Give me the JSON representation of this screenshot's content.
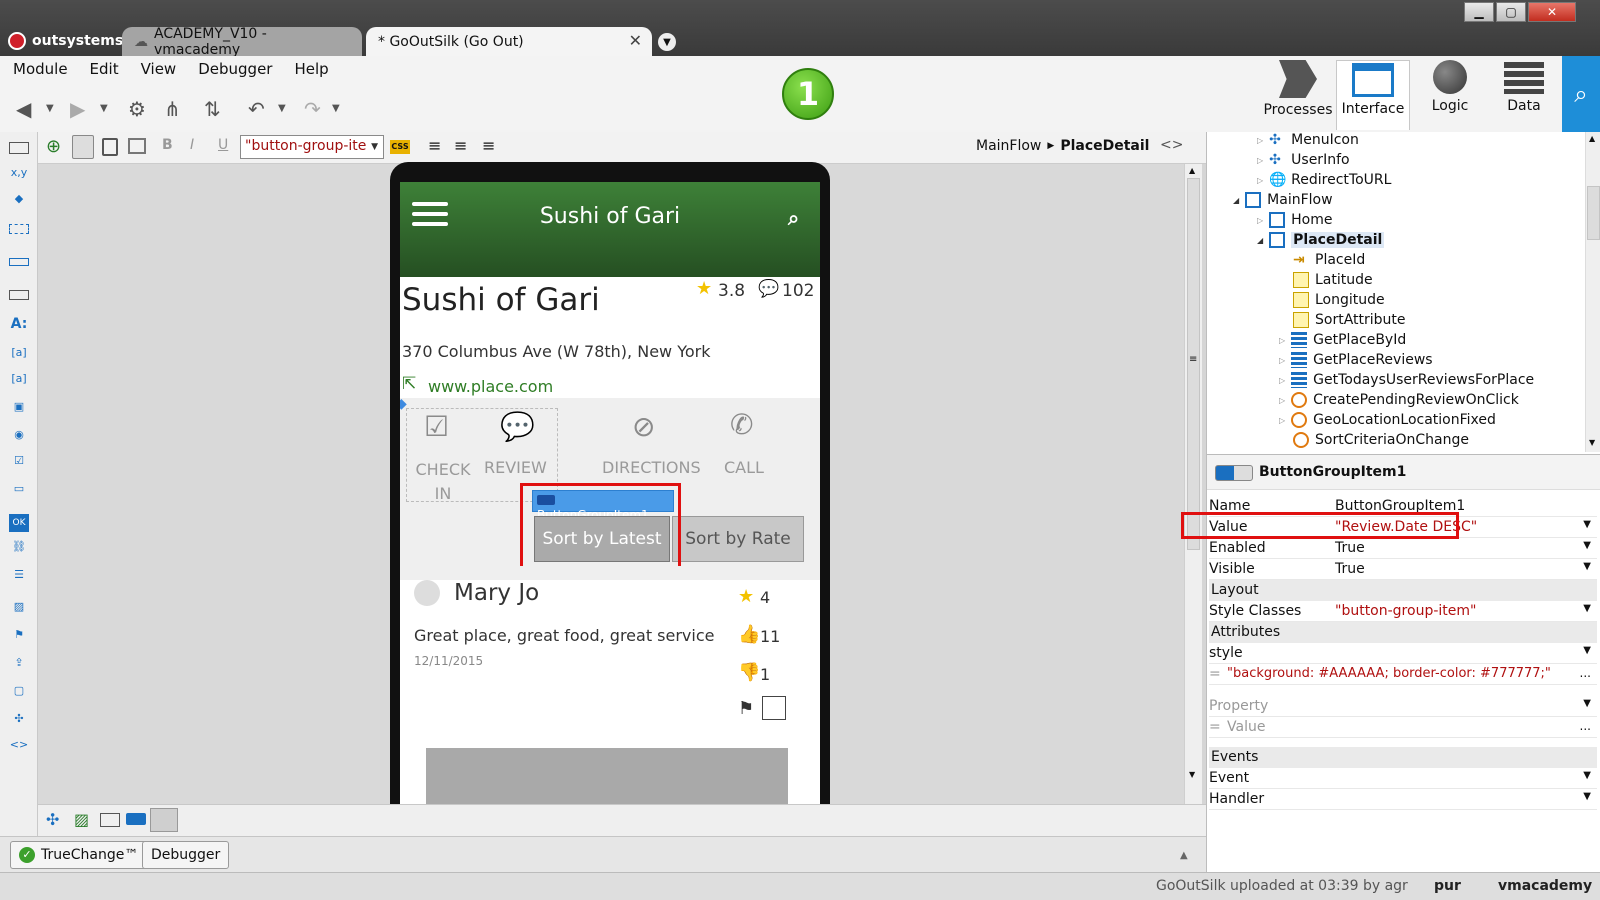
{
  "titlebar": {
    "logo": "outsystems",
    "tabs": [
      {
        "label": "ACADEMY_V10 - vmacademy"
      },
      {
        "label": "* GoOutSilk (Go Out)",
        "close": "✕"
      }
    ],
    "win": [
      "▁",
      "▢",
      "✕"
    ]
  },
  "menu": [
    "Module",
    "Edit",
    "View",
    "Debugger",
    "Help"
  ],
  "badge": "1",
  "modes": [
    {
      "label": "Processes"
    },
    {
      "label": "Interface"
    },
    {
      "label": "Logic"
    },
    {
      "label": "Data"
    }
  ],
  "editor": {
    "style_select": "\"button-group-ite",
    "breadcrumb": [
      "MainFlow",
      "PlaceDetail"
    ],
    "code": "<>"
  },
  "app": {
    "header_title": "Sushi of Gari",
    "name": "Sushi of Gari",
    "rating": "3.8",
    "comments": "102",
    "address": "370 Columbus Ave (W 78th), New York",
    "website": "www.place.com",
    "actions": [
      "CHECK IN",
      "REVIEW",
      "DIRECTIONS",
      "CALL"
    ],
    "tooltip": "ButtonGroupItem1",
    "sort_latest": "Sort by Latest",
    "sort_rate": "Sort by Rate",
    "review": {
      "author": "Mary Jo",
      "stars": "4",
      "text": "Great place, great food, great service",
      "date": "12/11/2015",
      "likes": "11",
      "dislikes": "1"
    }
  },
  "tree": [
    {
      "label": "MenuIcon"
    },
    {
      "label": "UserInfo"
    },
    {
      "label": "RedirectToURL"
    },
    {
      "label": "MainFlow"
    },
    {
      "label": "Home"
    },
    {
      "label": "PlaceDetail"
    },
    {
      "label": "PlaceId"
    },
    {
      "label": "Latitude"
    },
    {
      "label": "Longitude"
    },
    {
      "label": "SortAttribute"
    },
    {
      "label": "GetPlaceById"
    },
    {
      "label": "GetPlaceReviews"
    },
    {
      "label": "GetTodaysUserReviewsForPlace"
    },
    {
      "label": "CreatePendingReviewOnClick"
    },
    {
      "label": "GeoLocationLocationFixed"
    },
    {
      "label": "SortCriteriaOnChange"
    }
  ],
  "props": {
    "title": "ButtonGroupItem1",
    "name_k": "Name",
    "name_v": "ButtonGroupItem1",
    "value_k": "Value",
    "value_v": "\"Review.Date DESC\"",
    "enabled_k": "Enabled",
    "enabled_v": "True",
    "visible_k": "Visible",
    "visible_v": "True",
    "layout": "Layout",
    "styleclasses_k": "Style Classes",
    "styleclasses_v": "\"button-group-item\"",
    "attributes": "Attributes",
    "style_k": "style",
    "style_v": "\"background: #AAAAAA; border-color: #777777;\"",
    "eq": "=",
    "more": "...",
    "property_ph": "Property",
    "value_ph": "Value",
    "events": "Events",
    "event_k": "Event",
    "handler_k": "Handler"
  },
  "status": {
    "tabs": [
      "TrueChange™",
      "Debugger"
    ],
    "message": "GoOutSilk uploaded at 03:39 by agr",
    "user": "vmacademy",
    "pur": "pur"
  }
}
